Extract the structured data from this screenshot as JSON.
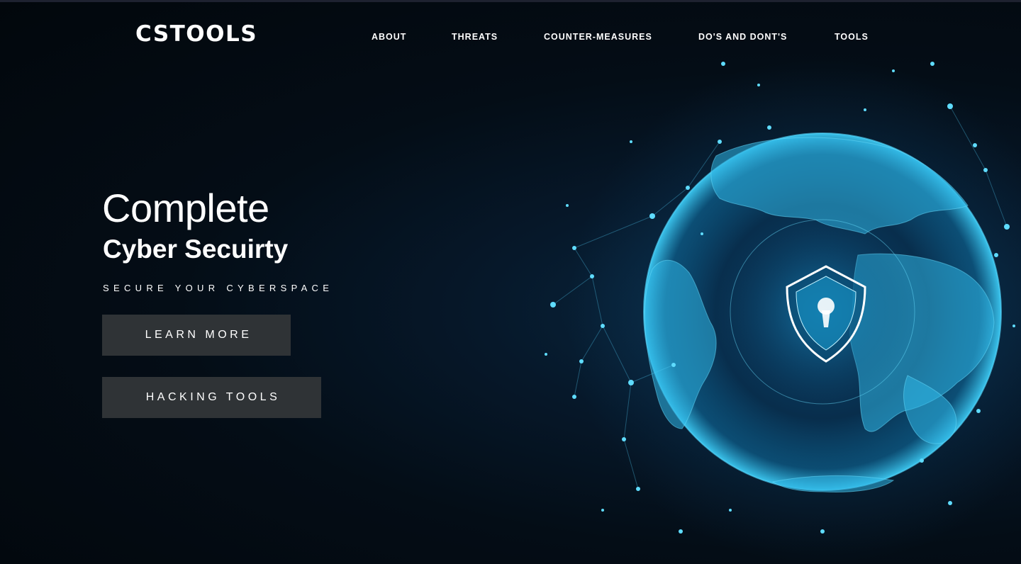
{
  "brand": {
    "logo_text": "CSTOOLS"
  },
  "nav": {
    "items": [
      {
        "label": "ABOUT"
      },
      {
        "label": "THREATS"
      },
      {
        "label": "COUNTER-MEASURES"
      },
      {
        "label": "DO'S AND DONT'S"
      },
      {
        "label": "TOOLS"
      }
    ]
  },
  "hero": {
    "title": "Complete",
    "subtitle": "Cyber Secuirty",
    "tagline": "SECURE YOUR CYBERSPACE",
    "buttons": {
      "learn_more": "LEARN MORE",
      "hacking_tools": "HACKING TOOLS"
    },
    "art": {
      "subject": "globe-with-shield-lock-illustration",
      "accent_color": "#3fd4ff"
    }
  },
  "colors": {
    "background": "#03080d",
    "button_bg": "#2f3336",
    "text": "#ffffff"
  }
}
